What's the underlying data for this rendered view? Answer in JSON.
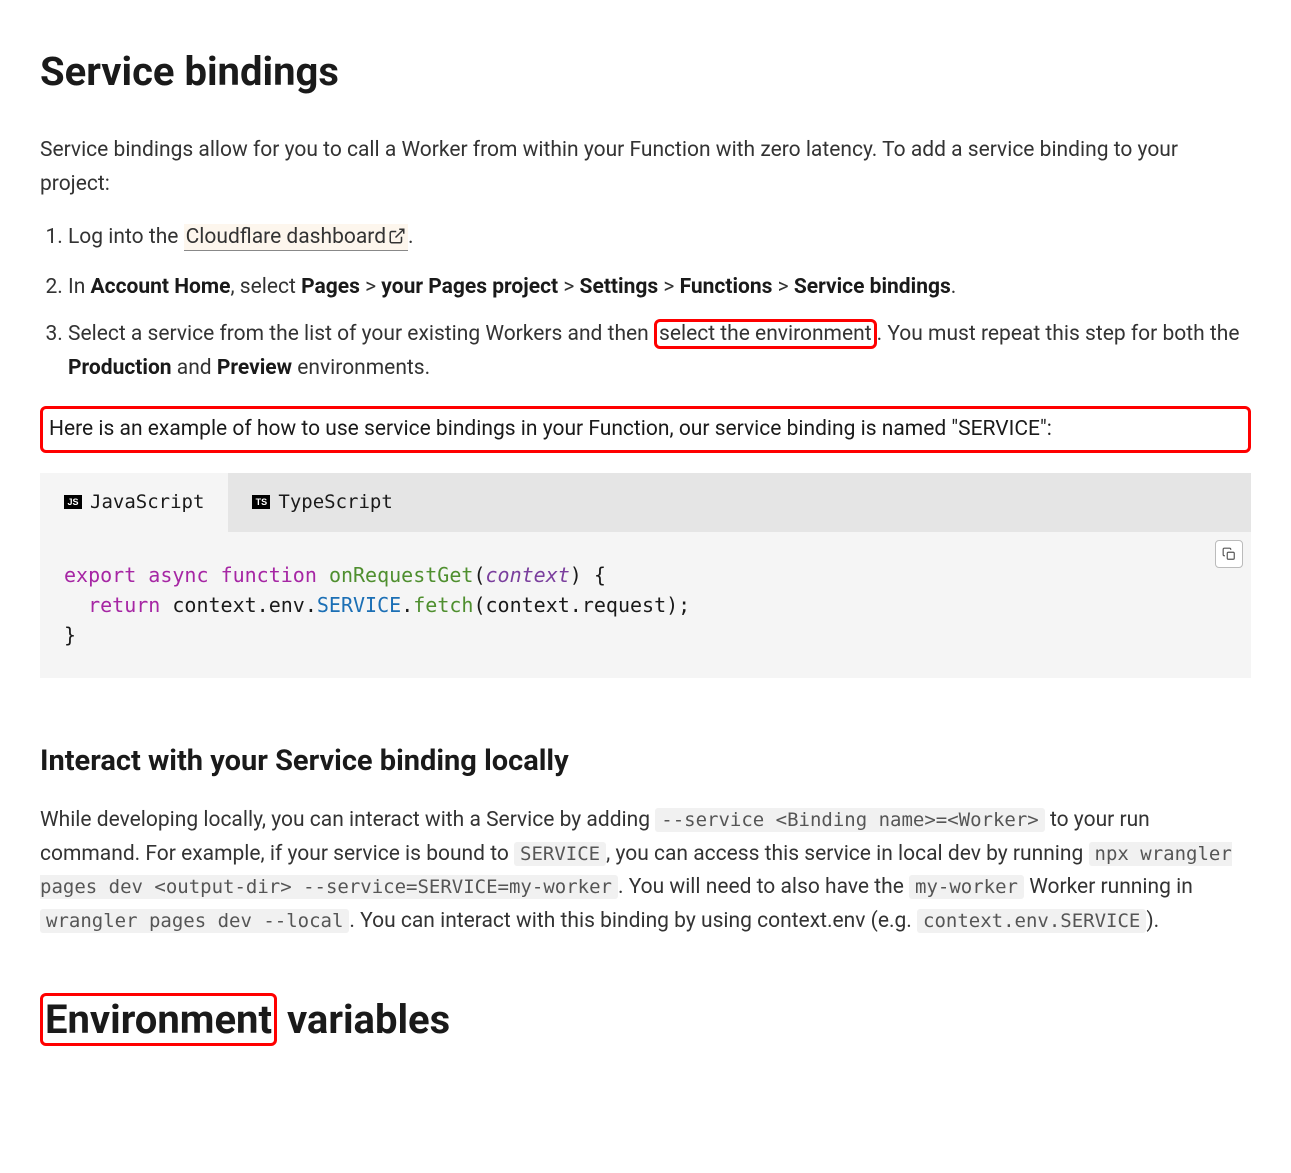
{
  "h1": "Service bindings",
  "intro": "Service bindings allow for you to call a Worker from within your Function with zero latency. To add a service binding to your project:",
  "steps": {
    "s1_prefix": "Log into the ",
    "s1_link": "Cloudflare dashboard",
    "s1_suffix": ".",
    "s2_prefix": "In ",
    "s2_b1": "Account Home",
    "s2_mid1": ", select ",
    "s2_b2": "Pages",
    "s2_gt": " > ",
    "s2_b3": "your Pages project",
    "s2_b4": "Settings",
    "s2_b5": "Functions",
    "s2_b6": "Service bindings",
    "s2_suffix": ".",
    "s3_prefix": "Select a service from the list of your existing Workers and then ",
    "s3_highlight": "select the environment",
    "s3_mid1": ". You must repeat this step for both the ",
    "s3_b1": "Production",
    "s3_mid2": " and ",
    "s3_b2": "Preview",
    "s3_suffix": " environments."
  },
  "example_intro": "Here is an example of how to use service bindings in your Function, our service binding is named \"SERVICE\":",
  "tabs": {
    "js": "JavaScript",
    "ts": "TypeScript",
    "js_icon": "JS",
    "ts_icon": "TS"
  },
  "code": {
    "t1": "export",
    "sp": " ",
    "t2": "async",
    "t3": "function",
    "t4": "onRequestGet",
    "po": "(",
    "t5": "context",
    "pc": ")",
    "bo": " {",
    "nl": "\n  ",
    "t6": "return",
    "t7": " context.env.",
    "t8": "SERVICE",
    "t9": ".",
    "t10": "fetch",
    "t11": "(context.request);",
    "nl2": "\n",
    "bc": "}"
  },
  "h2a": "Interact with your Service binding locally",
  "local": {
    "p1": "While developing locally, you can interact with a Service by adding ",
    "c1": "--service <Binding name>=<Worker>",
    "p2": " to your run command. For example, if your service is bound to ",
    "c2": "SERVICE",
    "p3": ", you can access this service in local dev by running ",
    "c3": "npx wrangler pages dev <output-dir> --service=SERVICE=my-worker",
    "p4": ". You will need to also have the ",
    "c4": "my-worker",
    "p5": " Worker running in ",
    "c5": "wrangler pages dev --local",
    "p6": ". You can interact with this binding by using context.env (e.g. ",
    "c6": "context.env.SERVICE",
    "p7": ")."
  },
  "h2b_hl": "Environment",
  "h2b_rest": " variables"
}
